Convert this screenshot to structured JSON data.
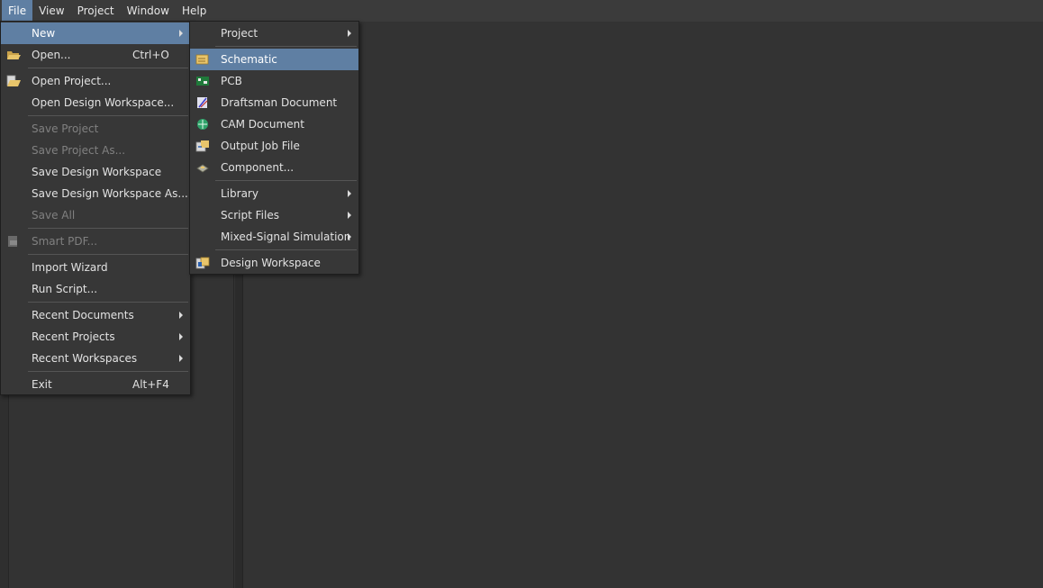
{
  "menubar": {
    "items": [
      {
        "label": "File"
      },
      {
        "label": "View"
      },
      {
        "label": "Project"
      },
      {
        "label": "Window"
      },
      {
        "label": "Help"
      }
    ]
  },
  "file_menu": {
    "new": "New",
    "open": "Open...",
    "open_shortcut": "Ctrl+O",
    "open_project": "Open Project...",
    "open_design_workspace": "Open Design Workspace...",
    "save_project": "Save Project",
    "save_project_as": "Save Project As...",
    "save_design_workspace": "Save Design Workspace",
    "save_design_workspace_as": "Save Design Workspace As...",
    "save_all": "Save All",
    "smart_pdf": "Smart PDF...",
    "import_wizard": "Import Wizard",
    "run_script": "Run Script...",
    "recent_documents": "Recent Documents",
    "recent_projects": "Recent Projects",
    "recent_workspaces": "Recent Workspaces",
    "exit": "Exit",
    "exit_shortcut": "Alt+F4"
  },
  "new_menu": {
    "project": "Project",
    "schematic": "Schematic",
    "pcb": "PCB",
    "draftsman_document": "Draftsman Document",
    "cam_document": "CAM Document",
    "output_job_file": "Output Job File",
    "component": "Component...",
    "library": "Library",
    "script_files": "Script Files",
    "mixed_signal_simulation": "Mixed-Signal Simulation",
    "design_workspace": "Design Workspace"
  },
  "colors": {
    "highlight": "#5f7fa3",
    "background": "#333333",
    "menu_bg": "#373737",
    "disabled_text": "#808080"
  }
}
